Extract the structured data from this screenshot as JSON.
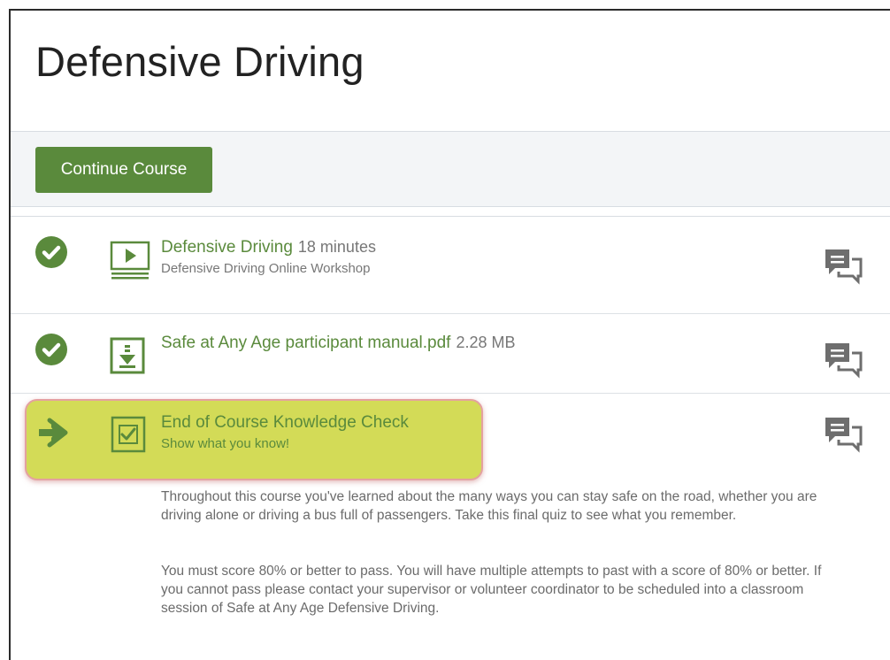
{
  "page": {
    "title": "Defensive Driving"
  },
  "toolbar": {
    "continue_label": "Continue Course"
  },
  "colors": {
    "accent_green": "#5a8a3c",
    "highlight": "#d3db57",
    "highlight_border": "#e4a1a0",
    "toolbar_bg": "#f3f5f7"
  },
  "course_items": [
    {
      "status_icon": "check-circle-icon",
      "type_icon": "video-icon",
      "title": "Defensive Driving",
      "meta": "18 minutes",
      "subtitle": "Defensive Driving Online Workshop",
      "action_icon": "comment-icon"
    },
    {
      "status_icon": "check-circle-icon",
      "type_icon": "download-icon",
      "title": "Safe at Any Age participant manual.pdf",
      "meta": "2.28 MB",
      "subtitle": "",
      "action_icon": "comment-icon"
    },
    {
      "status_icon": "arrow-right-icon",
      "type_icon": "checkbox-icon",
      "title": "End of Course Knowledge Check",
      "meta": "",
      "subtitle": "Show what you know!",
      "action_icon": "comment-icon",
      "description": [
        "Throughout this course you've learned about the many ways you can stay safe on the road, whether you are driving alone or driving a bus full of passengers.  Take this final quiz to see what you remember.",
        "You must score 80% or better to pass.  You will have multiple attempts to past with a score of 80% or better.  If you cannot pass please contact your supervisor or volunteer coordinator to be scheduled into a classroom session of Safe at Any Age Defensive Driving."
      ]
    }
  ]
}
